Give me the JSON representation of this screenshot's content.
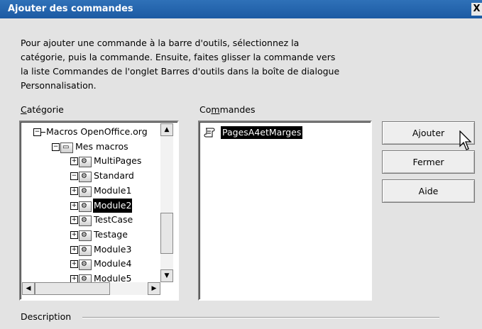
{
  "window": {
    "title": "Ajouter des commandes",
    "close_glyph": "X"
  },
  "intro": {
    "lines": [
      "Pour ajouter une commande à la barre d'outils, sélectionnez la",
      "catégorie, puis la commande. Ensuite, faites glisser la commande vers",
      "la liste Commandes de l'onglet Barres d'outils dans la boîte de dialogue",
      "Personnalisation."
    ]
  },
  "category": {
    "label_hotkey": "C",
    "label_rest": "atégorie",
    "tree": [
      {
        "text": "Macros OpenOffice.org",
        "expander": "−",
        "icon": "none",
        "selected": false
      },
      {
        "text": "Mes macros",
        "expander": "−",
        "icon": "drive-icon",
        "selected": false
      },
      {
        "text": "MultiPages",
        "expander": "+",
        "icon": "library-icon",
        "selected": false
      },
      {
        "text": "Standard",
        "expander": "−",
        "icon": "library-icon",
        "selected": false
      },
      {
        "text": "Module1",
        "expander": "+",
        "icon": "module-icon",
        "selected": false
      },
      {
        "text": "Module2",
        "expander": "+",
        "icon": "module-icon",
        "selected": true
      },
      {
        "text": "TestCase",
        "expander": "+",
        "icon": "module-icon",
        "selected": false
      },
      {
        "text": "Testage",
        "expander": "+",
        "icon": "module-icon",
        "selected": false
      },
      {
        "text": "Module3",
        "expander": "+",
        "icon": "module-icon",
        "selected": false
      },
      {
        "text": "Module4",
        "expander": "+",
        "icon": "module-icon",
        "selected": false
      },
      {
        "text": "Module5",
        "expander": "+",
        "icon": "module-icon",
        "selected": false
      }
    ]
  },
  "commands": {
    "label_pre": "Co",
    "label_hotkey": "m",
    "label_post": "mandes",
    "items": [
      {
        "text": "PagesA4etMarges",
        "icon": "macro-scroll-icon",
        "selected": true
      }
    ]
  },
  "buttons": {
    "add": "Ajouter",
    "close": "Fermer",
    "help": "Aide"
  },
  "description": {
    "label": "Description"
  },
  "colors": {
    "titlebar": "#2466b0",
    "dialog_bg": "#e3e3e3",
    "selection": "#000000"
  }
}
